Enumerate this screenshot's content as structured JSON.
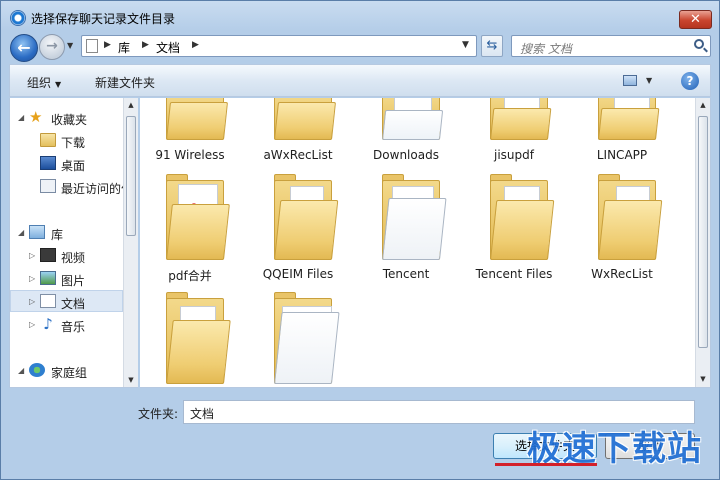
{
  "window": {
    "title": "选择保存聊天记录文件目录",
    "close_label": "✕"
  },
  "nav": {
    "back_label": "←",
    "forward_label": "→",
    "address": [
      "库",
      "文档"
    ],
    "search_placeholder": "搜索 文档"
  },
  "toolbar": {
    "organize_label": "组织",
    "new_folder_label": "新建文件夹",
    "help_label": "?"
  },
  "sidebar": {
    "items": [
      {
        "label": "收藏夹",
        "icon": "star-icon"
      },
      {
        "label": "下载",
        "icon": "download-folder-icon"
      },
      {
        "label": "桌面",
        "icon": "desktop-icon"
      },
      {
        "label": "最近访问的位置",
        "icon": "recent-places-icon"
      },
      {
        "label": "库",
        "icon": "library-icon"
      },
      {
        "label": "视频",
        "icon": "video-icon"
      },
      {
        "label": "图片",
        "icon": "picture-icon"
      },
      {
        "label": "文档",
        "icon": "document-icon",
        "selected": true
      },
      {
        "label": "音乐",
        "icon": "music-icon"
      },
      {
        "label": "家庭组",
        "icon": "homegroup-icon"
      }
    ]
  },
  "files": [
    {
      "name": "91 Wireless"
    },
    {
      "name": "aWxRecList"
    },
    {
      "name": "Downloads"
    },
    {
      "name": "jisupdf"
    },
    {
      "name": "LINCAPP"
    },
    {
      "name": "pdf合并"
    },
    {
      "name": "QQEIM Files"
    },
    {
      "name": "Tencent"
    },
    {
      "name": "Tencent Files"
    },
    {
      "name": "WxRecList"
    },
    {
      "name": ""
    },
    {
      "name": ""
    }
  ],
  "footer": {
    "folder_label": "文件夹:",
    "folder_value": "文档",
    "select_button": "选择文件夹",
    "cancel_button": "取消"
  },
  "watermark": "极速下载站",
  "colors": {
    "accent": "#3c7fb1",
    "folder": "#efcd72",
    "watermark": "#1f6ed4",
    "close": "#c9452e"
  }
}
